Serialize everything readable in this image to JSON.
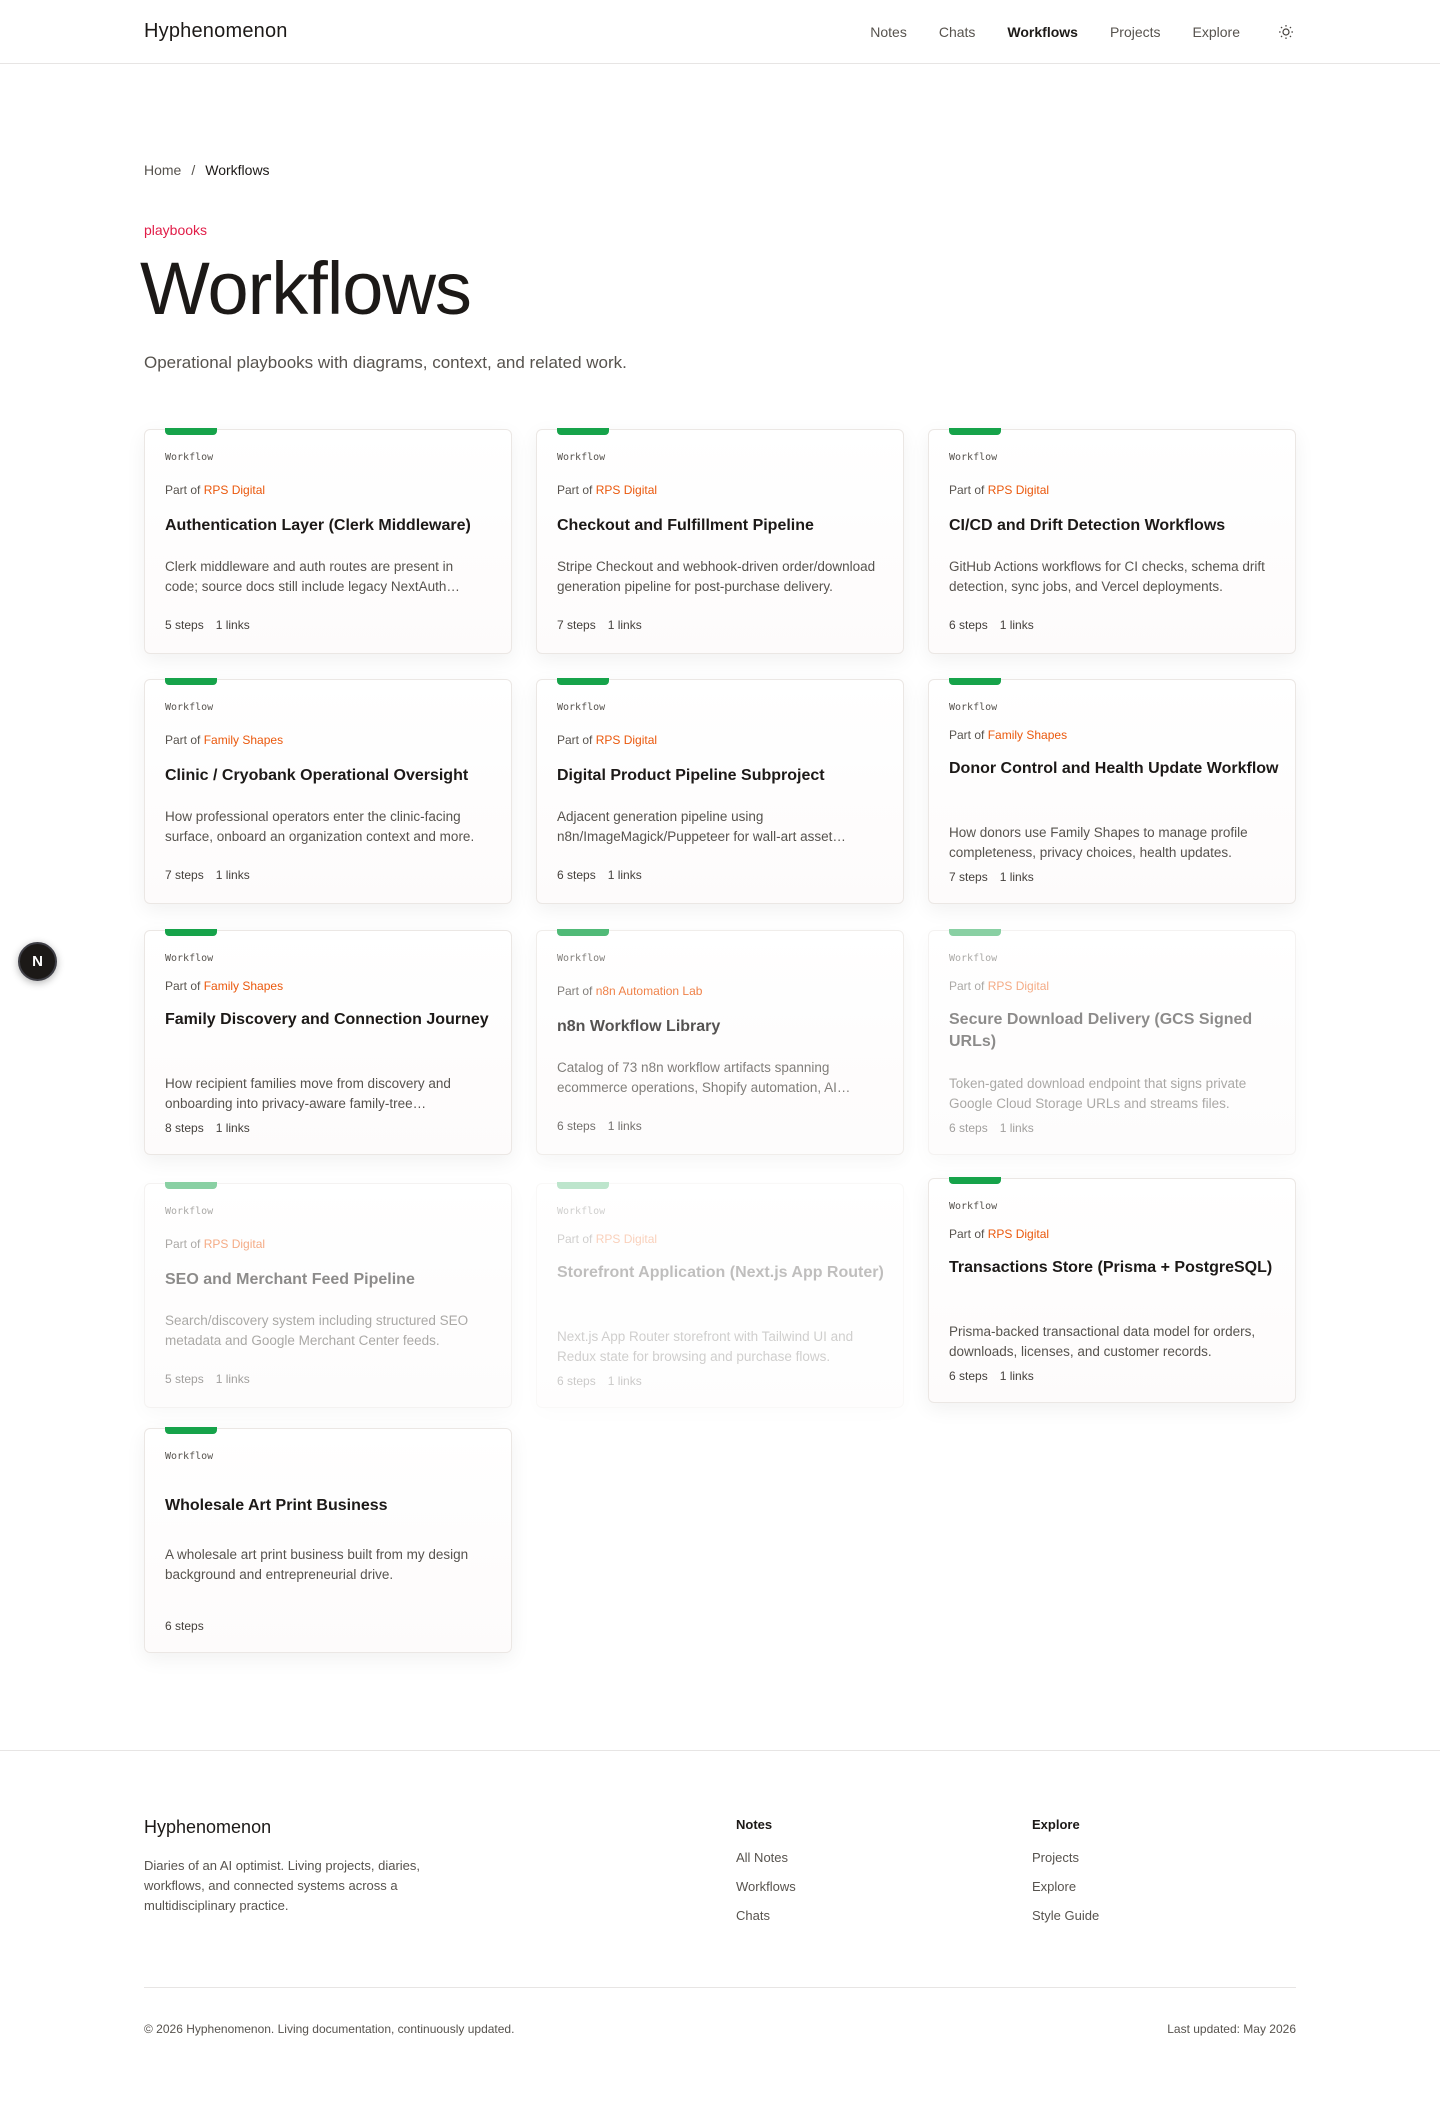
{
  "header": {
    "brand": "Hyphenomenon",
    "nav": [
      {
        "label": "Notes"
      },
      {
        "label": "Chats"
      },
      {
        "label": "Workflows"
      },
      {
        "label": "Projects"
      },
      {
        "label": "Explore"
      }
    ],
    "active_nav": "Workflows",
    "theme_icon": "sun-icon"
  },
  "breadcrumb": {
    "home": "Home",
    "separator": "/",
    "current": "Workflows"
  },
  "hero": {
    "eyebrow": "playbooks",
    "title": "Workflows",
    "subtitle": "Operational playbooks with diagrams, context, and related work."
  },
  "card_kind": "Workflow",
  "part_of_prefix": "Part of",
  "cards": [
    {
      "title": "Authentication Layer (Clerk Middleware)",
      "project": "RPS Digital",
      "description": "Clerk middleware and auth routes are present in code; source docs still include legacy NextAuth references.",
      "steps": "5 steps",
      "links": "1 links"
    },
    {
      "title": "Checkout and Fulfillment Pipeline",
      "project": "RPS Digital",
      "description": "Stripe Checkout and webhook-driven order/download generation pipeline for post-purchase delivery.",
      "steps": "7 steps",
      "links": "1 links"
    },
    {
      "title": "CI/CD and Drift Detection Workflows",
      "project": "RPS Digital",
      "description": "GitHub Actions workflows for CI checks, schema drift detection, sync jobs, and Vercel deployments.",
      "steps": "6 steps",
      "links": "1 links"
    },
    {
      "title": "Clinic / Cryobank Operational Oversight",
      "project": "Family Shapes",
      "description": "How professional operators enter the clinic-facing surface, onboard an organization context and more.",
      "steps": "7 steps",
      "links": "1 links"
    },
    {
      "title": "Digital Product Pipeline Subproject",
      "project": "RPS Digital",
      "description": "Adjacent generation pipeline using n8n/ImageMagick/Puppeteer for wall-art asset production.",
      "steps": "6 steps",
      "links": "1 links"
    },
    {
      "title": "Donor Control and Health Update Workflow",
      "project": "Family Shapes",
      "description": "How donors use Family Shapes to manage profile completeness, privacy choices, health updates.",
      "steps": "7 steps",
      "links": "1 links"
    },
    {
      "title": "Family Discovery and Connection Journey",
      "project": "Family Shapes",
      "description": "How recipient families move from discovery and onboarding into privacy-aware family-tree connections.",
      "steps": "8 steps",
      "links": "1 links"
    },
    {
      "title": "n8n Workflow Library",
      "project": "n8n Automation Lab",
      "description": "Catalog of 73 n8n workflow artifacts spanning ecommerce operations, Shopify automation, AI tooling.",
      "steps": "6 steps",
      "links": "1 links"
    },
    {
      "title": "Secure Download Delivery (GCS Signed URLs)",
      "project": "RPS Digital",
      "description": "Token-gated download endpoint that signs private Google Cloud Storage URLs and streams files.",
      "steps": "6 steps",
      "links": "1 links"
    },
    {
      "title": "SEO and Merchant Feed Pipeline",
      "project": "RPS Digital",
      "description": "Search/discovery system including structured SEO metadata and Google Merchant Center feeds.",
      "steps": "5 steps",
      "links": "1 links"
    },
    {
      "title": "Storefront Application (Next.js App Router)",
      "project": "RPS Digital",
      "description": "Next.js App Router storefront with Tailwind UI and Redux state for browsing and purchase flows.",
      "steps": "6 steps",
      "links": "1 links"
    },
    {
      "title": "Transactions Store (Prisma + PostgreSQL)",
      "project": "RPS Digital",
      "description": "Prisma-backed transactional data model for orders, downloads, licenses, and customer records.",
      "steps": "6 steps",
      "links": "1 links"
    },
    {
      "title": "Wholesale Art Print Business",
      "project": "",
      "description": "A wholesale art print business built from my design background and entrepreneurial drive.",
      "steps": "6 steps",
      "links": ""
    }
  ],
  "floating_badge": {
    "label": "N"
  },
  "footer": {
    "brand": "Hyphenomenon",
    "description": "Diaries of an AI optimist. Living projects, diaries, workflows, and connected systems across a multidisciplinary practice.",
    "columns": [
      {
        "heading": "Notes",
        "links": [
          "All Notes",
          "Workflows",
          "Chats"
        ]
      },
      {
        "heading": "Explore",
        "links": [
          "Projects",
          "Explore",
          "Style Guide"
        ]
      }
    ],
    "copyright": "© 2026 Hyphenomenon. Living documentation, continuously updated.",
    "last_updated": "Last updated: May 2026"
  },
  "colors": {
    "accent_bar": "#16a34a",
    "project_link": "#ea580c",
    "eyebrow": "#e11d48"
  }
}
